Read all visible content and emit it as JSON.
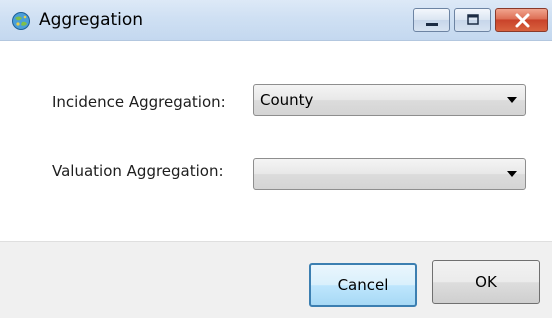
{
  "window": {
    "title": "Aggregation",
    "app_icon": "globe-icon",
    "controls": {
      "minimize_icon": "minimize-icon",
      "maximize_icon": "maximize-icon",
      "close_icon": "close-icon"
    }
  },
  "form": {
    "incidence": {
      "label": "Incidence Aggregation:",
      "value": "County"
    },
    "valuation": {
      "label": "Valuation Aggregation:",
      "value": ""
    }
  },
  "buttons": {
    "cancel_label": "Cancel",
    "ok_label": "OK"
  },
  "colors": {
    "titlebar": "#cfe0f3",
    "close_button": "#c9432a",
    "focus_border": "#3c7fb1",
    "footer": "#f0f0f0"
  }
}
